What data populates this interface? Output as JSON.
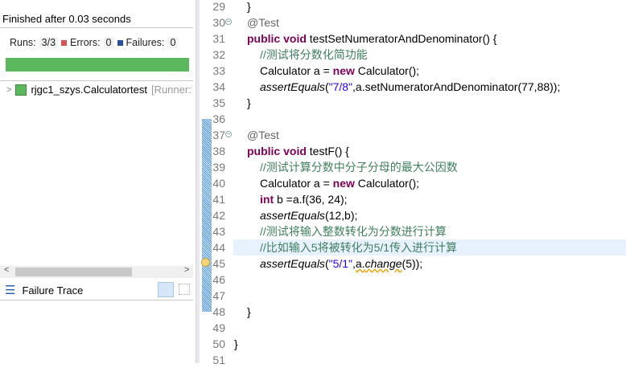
{
  "junit": {
    "status": "Finished after 0.03 seconds",
    "runs_label": "Runs:",
    "runs_value": "3/3",
    "errors_label": "Errors:",
    "errors_value": "0",
    "failures_label": "Failures:",
    "failures_value": "0",
    "progress_percent": 100,
    "bar_color": "#5cb85c",
    "tree_item": "rjgc1_szys.Calculatortest",
    "tree_item_suffix": "[Runner:",
    "failure_trace_label": "Failure Trace"
  },
  "editor": {
    "lines": [
      {
        "n": "29",
        "html": "<span>}</span>",
        "indent": 1
      },
      {
        "n": "30",
        "html": "<span class='ann'>@Test</span>",
        "indent": 1,
        "fold": true
      },
      {
        "n": "31",
        "html": "<span class='kw'>public</span> <span class='kw'>void</span> testSetNumeratorAndDenominator() {",
        "indent": 1
      },
      {
        "n": "32",
        "html": "<span class='cm'>//测试将分数化简功能</span>",
        "indent": 2
      },
      {
        "n": "33",
        "html": "Calculator a = <span class='kw'>new</span> Calculator();",
        "indent": 2
      },
      {
        "n": "34",
        "html": "<span class='it'>assertEquals</span>(<span class='st'>\"7/8\"</span>,a.setNumeratorAndDenominator(77,88));",
        "indent": 2
      },
      {
        "n": "35",
        "html": "}",
        "indent": 1
      },
      {
        "n": "36",
        "html": "",
        "indent": 1
      },
      {
        "n": "37",
        "html": "<span class='ann'>@Test</span>",
        "indent": 1,
        "fold": true
      },
      {
        "n": "38",
        "html": "<span class='kw'>public</span> <span class='kw'>void</span> testF() {",
        "indent": 1
      },
      {
        "n": "39",
        "html": "<span class='cm'>//测试计算分数中分子分母的最大公因数</span>",
        "indent": 2
      },
      {
        "n": "40",
        "html": "Calculator a = <span class='kw'>new</span> Calculator();",
        "indent": 2
      },
      {
        "n": "41",
        "html": "<span class='kw'>int</span> b =a.f(36, 24);",
        "indent": 2
      },
      {
        "n": "42",
        "html": "<span class='it'>assertEquals</span>(12,b);",
        "indent": 2
      },
      {
        "n": "43",
        "html": "<span class='cm'>//测试将输入整数转化为分数进行计算</span>",
        "indent": 2
      },
      {
        "n": "44",
        "html": "<span class='cm'>//比如输入5将被转化为5/1传入进行计算</span>",
        "indent": 2,
        "highlight": true
      },
      {
        "n": "45",
        "html": "<span class='it'>assertEquals</span>(<span class='st'>\"5/1\"</span>,<span class='warn'>a.<span class='it'>change</span></span>(5));",
        "indent": 2,
        "warning": true
      },
      {
        "n": "46",
        "html": "",
        "indent": 1
      },
      {
        "n": "47",
        "html": "",
        "indent": 1
      },
      {
        "n": "48",
        "html": "}",
        "indent": 1
      },
      {
        "n": "49",
        "html": "",
        "indent": 1
      },
      {
        "n": "50",
        "html": "}",
        "indent": 0
      },
      {
        "n": "51",
        "html": "",
        "indent": 0
      }
    ]
  }
}
